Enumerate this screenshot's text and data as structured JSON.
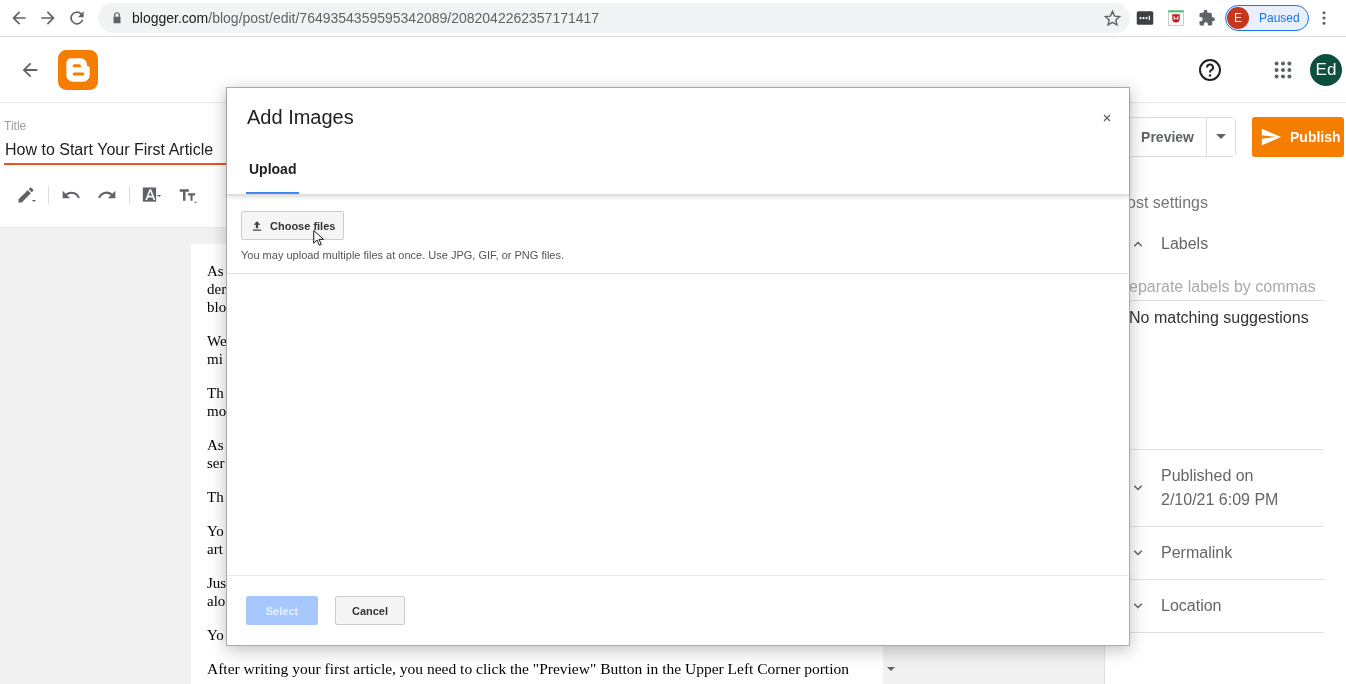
{
  "browser": {
    "url": "blogger.com/blog/post/edit/7649354359595342089/2082042262357171417",
    "profile": {
      "initial": "E",
      "status": "Paused"
    }
  },
  "header": {
    "avatar": "Ed"
  },
  "post": {
    "title_label": "Title",
    "title": "How to Start Your First Article",
    "paragraphs": [
      [
        "As",
        "der",
        "blo"
      ],
      [
        "We",
        "mi"
      ],
      [
        "Th",
        "mo"
      ],
      [
        "As",
        "ser"
      ],
      [
        "Th"
      ],
      [
        "Yo",
        "art"
      ],
      [
        "Jus",
        "alo"
      ],
      [
        "Yo"
      ]
    ],
    "last_line": "After writing your first article, you need to click the \"Preview\" Button in the Upper Left Corner portion"
  },
  "actions": {
    "preview": "Preview",
    "publish": "Publish"
  },
  "sidebar": {
    "heading": "ost settings",
    "sections": [
      {
        "label": "Labels",
        "expanded": true,
        "placeholder": "eparate labels by commas",
        "note": "No matching suggestions"
      },
      {
        "label": "Published on",
        "detail": "2/10/21 6:09 PM",
        "expanded": false
      },
      {
        "label": "Permalink",
        "expanded": false
      },
      {
        "label": "Location",
        "expanded": false
      }
    ]
  },
  "dialog": {
    "title": "Add Images",
    "tabs": [
      {
        "label": "Upload",
        "selected": true
      }
    ],
    "choose_button": "Choose files",
    "hint": "You may upload multiple files at once. Use JPG, GIF, or PNG files.",
    "buttons": [
      {
        "label": "Select",
        "disabled": true
      },
      {
        "label": "Cancel",
        "disabled": false
      }
    ]
  }
}
